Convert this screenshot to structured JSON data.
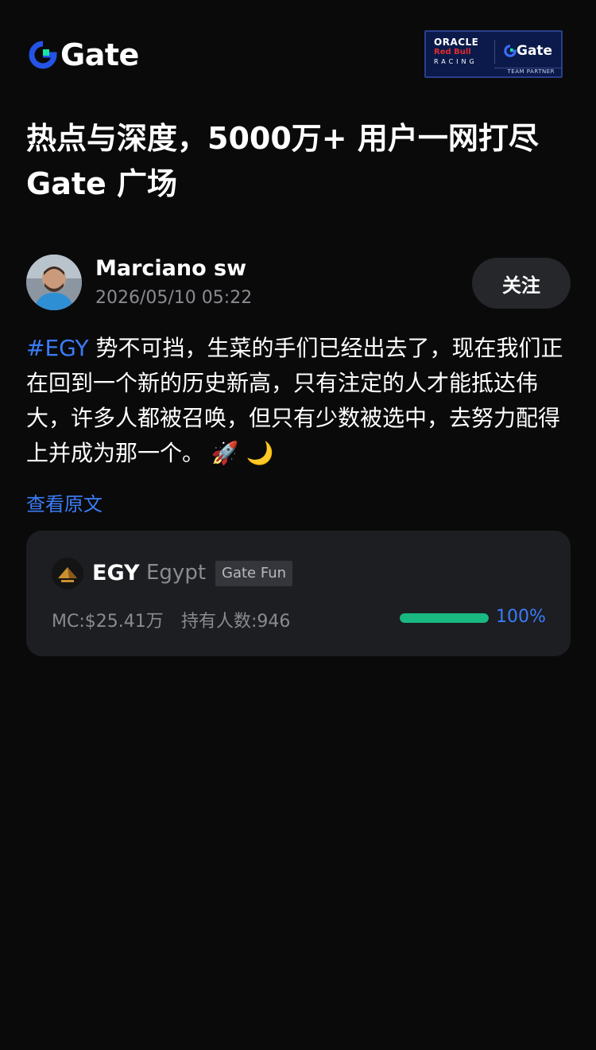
{
  "header": {
    "brand": "Gate",
    "partner": {
      "oracle": "ORACLE",
      "redbull": "Red Bull",
      "racing": "RACING",
      "brand": "Gate",
      "team": "TEAM PARTNER"
    }
  },
  "headline": {
    "line1": "热点与深度，5000万+ 用户一网打尽",
    "line2": "Gate 广场"
  },
  "post": {
    "author": "Marciano sw",
    "time": "2026/05/10 05:22",
    "follow_label": "关注",
    "hashtag": "#EGY",
    "body": " 势不可挡，生菜的手们已经出去了，现在我们正在回到一个新的历史新高，只有注定的人才能抵达伟大，许多人都被召唤，但只有少数被选中，去努力配得上并成为那一个。",
    "emoji": " 🚀 🌙",
    "translate_label": "查看原文"
  },
  "token": {
    "symbol": "EGY",
    "name": "Egypt",
    "tag": "Gate Fun",
    "market_cap": "MC:$25.41万",
    "holders": "持有人数:946",
    "progress_percent": 100,
    "progress_label": "100%"
  },
  "colors": {
    "background": "#0a0a0b",
    "accent_blue": "#3b7cf6",
    "progress_green": "#19b981",
    "card": "#1c1e22"
  }
}
